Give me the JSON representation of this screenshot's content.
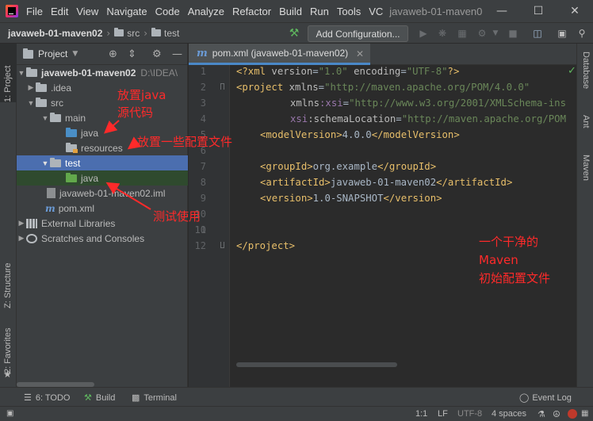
{
  "menu": {
    "items": [
      "File",
      "Edit",
      "View",
      "Navigate",
      "Code",
      "Analyze",
      "Refactor",
      "Build",
      "Run",
      "Tools",
      "VC"
    ],
    "window_title": "javaweb-01-maven0"
  },
  "navbar": {
    "project": "javaweb-01-maven02",
    "crumbs": [
      "src",
      "test"
    ],
    "add_configuration": "Add Configuration..."
  },
  "left_strip": {
    "project_tab": "1: Project",
    "structure_tab": "Z: Structure",
    "favorites_tab": "2: Favorites"
  },
  "right_strip": {
    "database": "Database",
    "ant": "Ant",
    "maven": "Maven"
  },
  "project_panel": {
    "title": "Project",
    "tree": {
      "root": "javaweb-01-maven02",
      "root_path": "D:\\IDEA\\",
      "idea": ".idea",
      "src": "src",
      "main": "main",
      "main_java": "java",
      "resources": "resources",
      "test": "test",
      "test_java": "java",
      "iml": "javaweb-01-maven02.iml",
      "pom": "pom.xml",
      "external_libraries": "External Libraries",
      "scratches": "Scratches and Consoles"
    }
  },
  "editor": {
    "tab_label": "pom.xml (javaweb-01-maven02)",
    "line_numbers": [
      "1",
      "2",
      "3",
      "4",
      "5",
      "6",
      "7",
      "8",
      "9",
      "10",
      "11",
      "12"
    ],
    "code": {
      "l1_a": "<?xml ",
      "l1_b": "version",
      "l1_c": "=",
      "l1_d": "\"1.0\" ",
      "l1_e": "encoding",
      "l1_f": "=",
      "l1_g": "\"UTF-8\"",
      "l1_h": "?>",
      "l2_a": "<project ",
      "l2_b": "xmlns",
      "l2_c": "=",
      "l2_d": "\"http://maven.apache.org/POM/4.0.0\"",
      "l3_a": "xmlns",
      "l3_b": ":xsi",
      "l3_c": "=",
      "l3_d": "\"http://www.w3.org/2001/XMLSchema-ins",
      "l4_a": "xsi",
      "l4_b": ":schemaLocation",
      "l4_c": "=",
      "l4_d": "\"http://maven.apache.org/POM",
      "l5_a": "<modelVersion>",
      "l5_b": "4.0.0",
      "l5_c": "</modelVersion>",
      "l7_a": "<groupId>",
      "l7_b": "org.example",
      "l7_c": "</groupId>",
      "l8_a": "<artifactId>",
      "l8_b": "javaweb-01-maven02",
      "l8_c": "</artifactId>",
      "l9_a": "<version>",
      "l9_b": "1.0-SNAPSHOT",
      "l9_c": "</version>",
      "l12_a": "</project>"
    }
  },
  "annotations": {
    "java_source_1": "放置java",
    "java_source_2": "源代码",
    "resources": "放置一些配置文件",
    "test_use": "测试使用",
    "maven_1": "一个干净的",
    "maven_2": "Maven",
    "maven_3": "初始配置文件"
  },
  "bottom_tools": {
    "todo": "6: TODO",
    "build": "Build",
    "terminal": "Terminal",
    "event_log": "Event Log"
  },
  "status_bar": {
    "position": "1:1",
    "line_sep": "LF",
    "encoding": "UTF-8",
    "indent": "4 spaces"
  },
  "colors": {
    "annotation": "#ff2a2a",
    "selection": "#4b6eaf",
    "xml_tag": "#e8bf6a",
    "xml_string": "#6a8759"
  }
}
